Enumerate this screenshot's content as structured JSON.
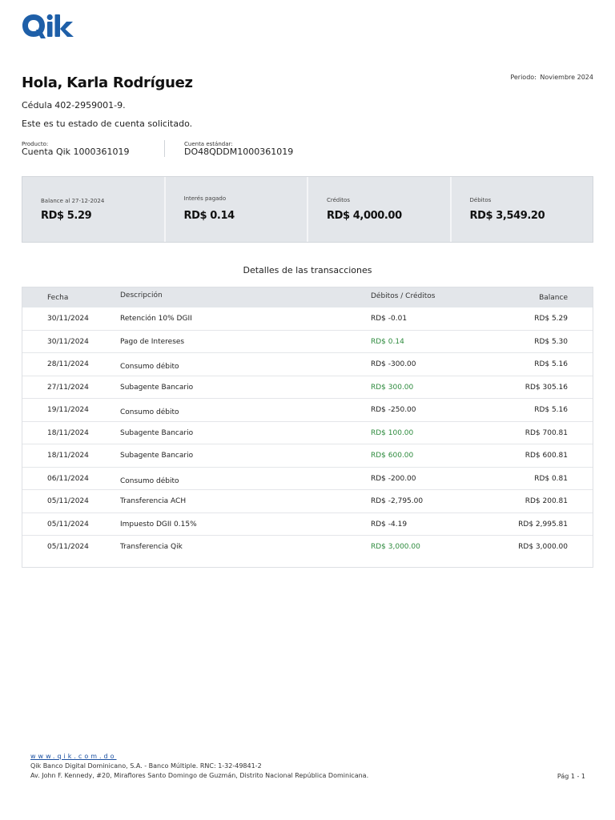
{
  "brand": {
    "logo_text": "Qik"
  },
  "header": {
    "period_label": "Periodo:",
    "period_value": "Noviembre 2024",
    "greeting": "Hola,",
    "customer_name": "Karla Rodríguez",
    "cedula_label": "Cédula",
    "cedula_value": "402-2959001-9.",
    "intro": "Este es tu estado de cuenta solicitado."
  },
  "product": {
    "product_label": "Producto:",
    "product_value": "Cuenta Qik 1000361019",
    "account_label": "Cuenta estándar:",
    "account_value": "DO48QDDM1000361019"
  },
  "summary": [
    {
      "label": "Balance al 27-12-2024",
      "value": "RD$ 5.29"
    },
    {
      "label": "Interés pagado",
      "value": "RD$ 0.14"
    },
    {
      "label": "Créditos",
      "value": "RD$ 4,000.00"
    },
    {
      "label": "Débitos",
      "value": "RD$ 3,549.20"
    }
  ],
  "transactions": {
    "title": "Detalles de las transacciones",
    "headers": {
      "date": "Fecha",
      "description": "Descripción",
      "amount": "Débitos / Créditos",
      "balance": "Balance"
    },
    "rows": [
      {
        "date": "30/11/2024",
        "description": "Retención 10% DGII",
        "amount": "RD$ -0.01",
        "balance": "RD$ 5.29",
        "credit": false
      },
      {
        "date": "30/11/2024",
        "description": "Pago de Intereses",
        "amount": "RD$ 0.14",
        "balance": "RD$ 5.30",
        "credit": true
      },
      {
        "date": "28/11/2024",
        "description": "Consumo débito",
        "amount": "RD$ -300.00",
        "balance": "RD$ 5.16",
        "credit": false
      },
      {
        "date": "27/11/2024",
        "description": "Subagente Bancario",
        "amount": "RD$ 300.00",
        "balance": "RD$ 305.16",
        "credit": true
      },
      {
        "date": "19/11/2024",
        "description": "Consumo débito",
        "amount": "RD$ -250.00",
        "balance": "RD$ 5.16",
        "credit": false
      },
      {
        "date": "18/11/2024",
        "description": "Subagente Bancario",
        "amount": "RD$ 100.00",
        "balance": "RD$ 700.81",
        "credit": true
      },
      {
        "date": "18/11/2024",
        "description": "Subagente Bancario",
        "amount": "RD$ 600.00",
        "balance": "RD$ 600.81",
        "credit": true
      },
      {
        "date": "06/11/2024",
        "description": "Consumo débito",
        "amount": "RD$ -200.00",
        "balance": "RD$ 0.81",
        "credit": false
      },
      {
        "date": "05/11/2024",
        "description": "Transferencia ACH",
        "amount": "RD$ -2,795.00",
        "balance": "RD$ 200.81",
        "credit": false
      },
      {
        "date": "05/11/2024",
        "description": "Impuesto DGII 0.15%",
        "amount": "RD$ -4.19",
        "balance": "RD$ 2,995.81",
        "credit": false
      },
      {
        "date": "05/11/2024",
        "description": "Transferencia Qik",
        "amount": "RD$ 3,000.00",
        "balance": "RD$ 3,000.00",
        "credit": true
      }
    ]
  },
  "colors": {
    "brand_blue": "#1e5fa8",
    "credit_green": "#2e8b3e",
    "panel_gray": "#e3e6ea"
  },
  "footer": {
    "website": "www.qik.com.do",
    "company": "Qik Banco Digital Dominicano, S.A. - Banco Múltiple. RNC: 1-32-49841-2",
    "address": "Av. John F. Kennedy, #20, Miraflores Santo Domingo de Guzmán, Distrito Nacional República Dominicana.",
    "page": "Pág 1 - 1"
  }
}
